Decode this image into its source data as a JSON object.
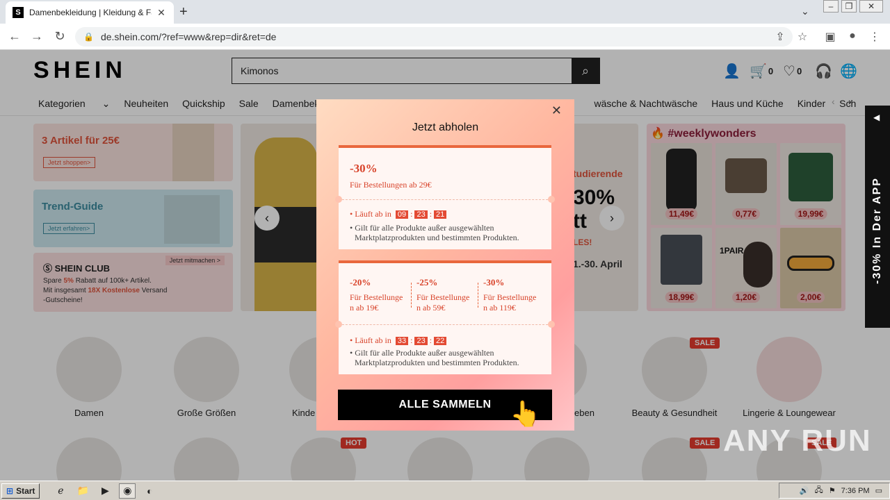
{
  "browser": {
    "tab_title": "Damenbekleidung | Kleidung & Fashion",
    "url": "de.shein.com/?ref=www&rep=dir&ret=de"
  },
  "header": {
    "logo": "SHEIN",
    "search_value": "Kimonos",
    "cart_count": "0",
    "wishlist_count": "0"
  },
  "catnav": {
    "items": [
      "Kategorien",
      "Neuheiten",
      "Quickship",
      "Sale",
      "Damenbekleidung",
      "wäsche & Nachtwäsche",
      "Haus und Küche",
      "Kinder",
      "Sch"
    ]
  },
  "banners": {
    "left1_title": "3 Artikel für 25€",
    "left1_btn": "Jetzt shoppen>",
    "left2_title": "Trend-Guide",
    "left2_btn": "Jetzt erfahren>",
    "club_title": "SHEIN CLUB",
    "club_link": "Jetzt mitmachen >",
    "club_line1_a": "Spare ",
    "club_line1_b": "5%",
    "club_line1_c": " Rabatt auf 100k+ Artikel.",
    "club_line2_a": "Mit insgesamt ",
    "club_line2_b": "18X Kostenlose",
    "club_line2_c": " Versand",
    "club_line3": "-Gutscheine!",
    "student_text1": "tudierende",
    "student_text2": "30%",
    "student_text3": "tt",
    "student_text4": "LES!",
    "student_text5": "1.-30. April",
    "weekly_title": "#weeklywonders",
    "prices": [
      "11,49€",
      "0,77€",
      "19,99€",
      "18,99€",
      "1,20€",
      "2,00€"
    ],
    "pair_label": "1PAIR"
  },
  "categories": {
    "items": [
      "Damen",
      "Große Größen",
      "Kinde",
      "eben",
      "Beauty & Gesundheit",
      "Lingerie & Loungewear"
    ],
    "badge_sale": "SALE",
    "badge_hot": "HOT"
  },
  "sidetab": {
    "text": "-30% In Der APP"
  },
  "modal": {
    "title": "Jetzt abholen",
    "coupon1": {
      "discount": "-30%",
      "condition": "Für Bestellungen ab 29€",
      "expires_label": "Läuft ab in",
      "t1": "09",
      "t2": "23",
      "t3": "21",
      "desc1": "Gilt für alle Produkte außer ausgewählten",
      "desc2": "Marktplatzprodukten und bestimmten Produkten."
    },
    "coupon2": {
      "tiers": [
        {
          "discount": "-20%",
          "line1": "Für Bestellunge",
          "line2": "n ab 19€"
        },
        {
          "discount": "-25%",
          "line1": "Für Bestellunge",
          "line2": "n ab 59€"
        },
        {
          "discount": "-30%",
          "line1": "Für Bestellunge",
          "line2": "n ab 119€"
        }
      ],
      "expires_label": "Läuft ab in",
      "t1": "33",
      "t2": "23",
      "t3": "22",
      "desc1": "Gilt für alle Produkte außer ausgewählten",
      "desc2": "Marktplatzprodukten und bestimmten Produkten."
    },
    "collect_label": "ALLE SAMMELN"
  },
  "watermark": "ANY RUN",
  "taskbar": {
    "start": "Start",
    "clock": "7:36 PM"
  },
  "colors": {
    "accent": "#e9673d",
    "coupon_text": "#d8432a",
    "sale_badge": "#e63c2e"
  }
}
